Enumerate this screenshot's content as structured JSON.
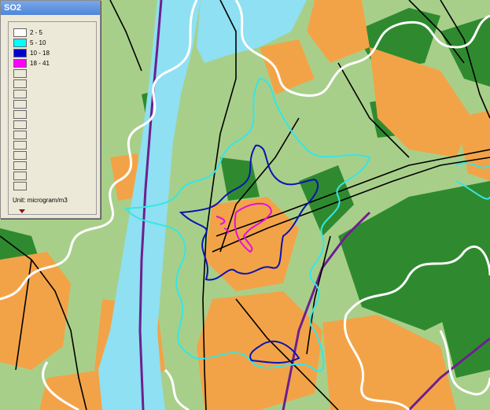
{
  "window": {
    "title": "SO2"
  },
  "legend": {
    "items": [
      {
        "label": "2 - 5",
        "color": "#ffffff"
      },
      {
        "label": "5 - 10",
        "color": "#00ffff"
      },
      {
        "label": "10 - 18",
        "color": "#0000cc"
      },
      {
        "label": "18 - 41",
        "color": "#ff00ff"
      }
    ],
    "empty_rows": 12,
    "unit": "Unit: microgram/m3",
    "menu_icon": "down-arrow-icon"
  },
  "map": {
    "colors": {
      "background": "#a8cf8a",
      "water": "#8ee0f2",
      "forest": "#2f8a2f",
      "urban": "#f3a347",
      "roads": "#000000",
      "railway": "#6e1f8f",
      "contour_2_5": "#ffffff",
      "contour_5_10": "#36e6e6",
      "contour_10_18": "#0a14b4",
      "contour_18_41": "#e010e0"
    }
  }
}
